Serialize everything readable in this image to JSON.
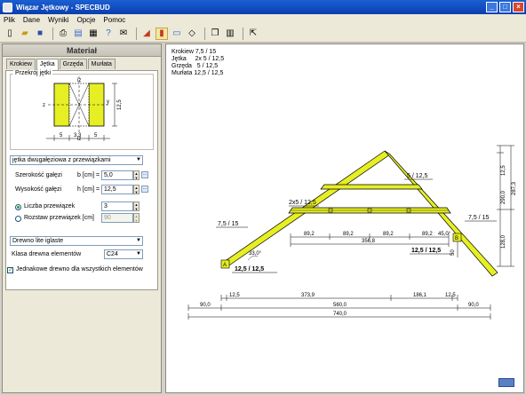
{
  "window": {
    "title": "Wiązar Jętkowy - SPECBUD",
    "buttons": [
      "_",
      "□",
      "×"
    ]
  },
  "menu": [
    "Plik",
    "Dane",
    "Wyniki",
    "Opcje",
    "Pomoc"
  ],
  "panel": {
    "header": "Materiał",
    "tabs": [
      "Krokiew",
      "Jętka",
      "Grzęda",
      "Murłata"
    ],
    "active_tab": "Jętka",
    "section_group_label": "Przekrój jętki",
    "section_labels": {
      "y_top": "iz",
      "y_bot": "iz",
      "z_left": "z",
      "y_right": "y",
      "height": "12,5",
      "widths": [
        "5",
        "3,3",
        "5"
      ]
    },
    "type_select": "jętka dwugałęziowa z przewiązkami",
    "width_label": "Szerokość gałęzi",
    "width_unit": "b [cm] =",
    "width_value": "5,0",
    "height_label": "Wysokość gałęzi",
    "height_unit": "h [cm] =",
    "height_value": "12,5",
    "count_label": "Liczba przewiązek",
    "count_value": "3",
    "spacing_label": "Rozstaw przewiązek [cm]",
    "spacing_value": "90",
    "wood_select": "Drewno lite iglaste",
    "class_label": "Klasa drewna elementów",
    "class_value": "C24",
    "same_wood_label": "Jednakowe drewno dla wszystkich elementów",
    "dots": "..."
  },
  "materials_text": "Krokiew 7,5 / 15\nJętka     2x 5 / 12,5\nGrzęda   5 / 12,5\nMurłata 12,5 / 12,5",
  "drawing": {
    "labels": {
      "grzeda": "5 / 12,5",
      "jetka": "2x5 / 12,5",
      "krokiew_left": "7,5 / 15",
      "krokiew_right": "7,5 / 15",
      "murlata_left": "12,5 / 12,5",
      "murlata_right": "12,5 / 12,5",
      "angle": "33,0°",
      "angle_right": "45,0°",
      "a": "A",
      "b": "B"
    },
    "dim_top": [
      "89,2",
      "89,2",
      "89,2",
      "89,2"
    ],
    "dim_total_top": "356,8",
    "dim_bottom1": [
      "12,5",
      "373,9",
      "186,1",
      "12,5"
    ],
    "dim_bottom2": [
      "90,0",
      "560,0",
      "90,0"
    ],
    "dim_bottom3": "740,0",
    "dim_right": [
      "12,5",
      "290,0",
      "287,3",
      "128,0",
      "50"
    ]
  },
  "colors": {
    "timber": "#e6ef23",
    "outline": "#000000"
  }
}
